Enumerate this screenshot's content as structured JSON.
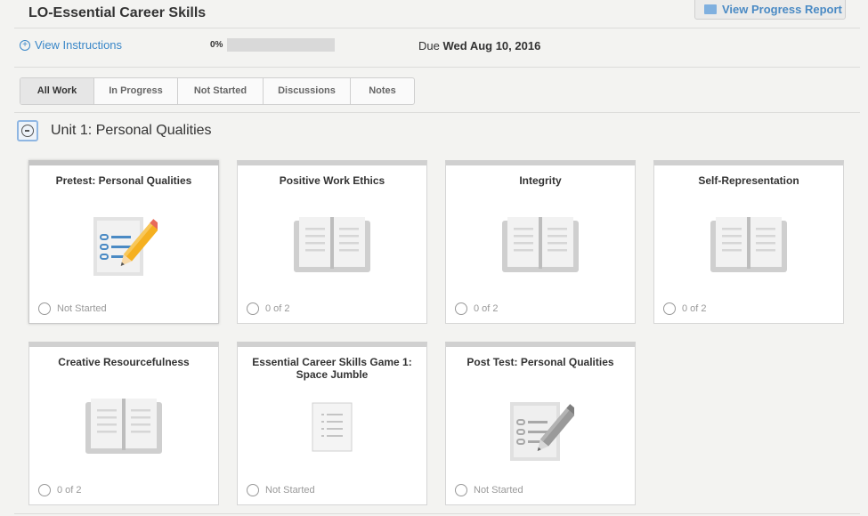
{
  "header": {
    "title": "LO-Essential Career Skills",
    "progress_report_label": "View Progress Report"
  },
  "info": {
    "instructions_label": "View Instructions",
    "progress_percent": 0,
    "progress_label": "0%",
    "due_prefix": "Due",
    "due_date": "Wed Aug 10, 2016"
  },
  "tabs": [
    {
      "label": "All Work",
      "active": true
    },
    {
      "label": "In Progress",
      "active": false
    },
    {
      "label": "Not Started",
      "active": false
    },
    {
      "label": "Discussions",
      "active": false
    },
    {
      "label": "Notes",
      "active": false
    }
  ],
  "unit": {
    "title": "Unit 1: Personal Qualities"
  },
  "cards": [
    {
      "title": "Pretest: Personal Qualities",
      "icon": "pretest-icon",
      "status": "Not Started"
    },
    {
      "title": "Positive Work Ethics",
      "icon": "book-icon",
      "status": "0 of 2"
    },
    {
      "title": "Integrity",
      "icon": "book-icon",
      "status": "0 of 2"
    },
    {
      "title": "Self-Representation",
      "icon": "book-icon",
      "status": "0 of 2"
    },
    {
      "title": "Creative Resourcefulness",
      "icon": "book-icon",
      "status": "0 of 2"
    },
    {
      "title": "Essential Career Skills Game 1: Space Jumble",
      "icon": "document-icon",
      "status": "Not Started"
    },
    {
      "title": "Post Test: Personal Qualities",
      "icon": "posttest-icon",
      "status": "Not Started"
    }
  ],
  "colors": {
    "link": "#3a87c8",
    "pencil": "#f5b020",
    "pencil_gray": "#9a9a9a"
  }
}
